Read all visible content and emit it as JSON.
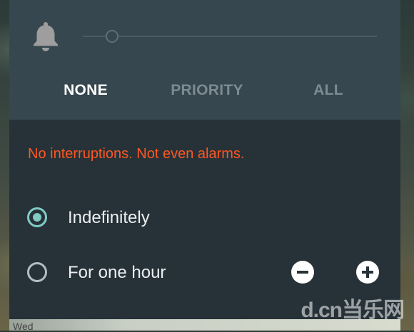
{
  "volume": {
    "icon": "bell-icon",
    "slider_level": 0.1
  },
  "tabs": [
    {
      "label": "NONE",
      "active": true
    },
    {
      "label": "PRIORITY",
      "active": false
    },
    {
      "label": "ALL",
      "active": false
    }
  ],
  "message": "No interruptions. Not even alarms.",
  "duration_options": [
    {
      "label": "Indefinitely",
      "selected": true
    },
    {
      "label": "For one hour",
      "selected": false
    }
  ],
  "stepper": {
    "minus_icon": "minus-circle-icon",
    "plus_icon": "plus-circle-icon"
  },
  "peek_text": "Wed",
  "watermark": "d.cn当乐网",
  "colors": {
    "panel_bg": "#263238",
    "header_bg": "#37474f",
    "accent": "#80cbc4",
    "warning": "#ff5722"
  }
}
